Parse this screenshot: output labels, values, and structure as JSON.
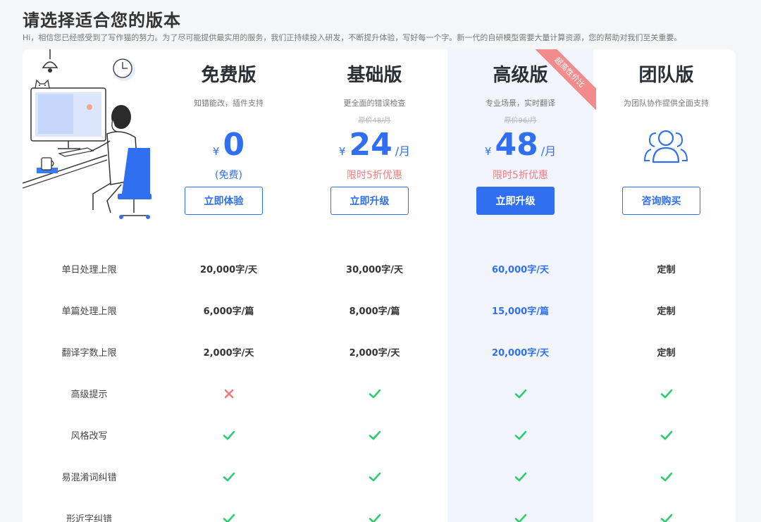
{
  "header": {
    "title": "请选择适合您的版本",
    "subtitle": "Hi，相信您已经感受到了写作猫的努力。为了尽可能提供最实用的服务，我们正持续投入研发，不断提升体验，写好每一个字。新一代的自研模型需要大量计算资源，您的帮助对我们至关重要。"
  },
  "plans": [
    {
      "name": "免费版",
      "desc": "知错能改，插件支持",
      "currency": "¥",
      "price": "0",
      "note": "(免费)",
      "button": "立即体验"
    },
    {
      "name": "基础版",
      "desc": "更全面的错误检查",
      "original": "原价48/月",
      "currency": "¥",
      "price": "24",
      "unit": "/月",
      "promo": "限时5折优惠",
      "button": "立即升级"
    },
    {
      "name": "高级版",
      "desc": "专业场景，实时翻译",
      "original": "原价96/月",
      "currency": "¥",
      "price": "48",
      "unit": "/月",
      "promo": "限时5折优惠",
      "button": "立即升级",
      "ribbon": "超高性价比"
    },
    {
      "name": "团队版",
      "desc": "为团队协作提供全面支持",
      "icon": "team-icon",
      "button": "咨询购买"
    }
  ],
  "features": [
    {
      "label": "单日处理上限",
      "values": [
        "20,000字/天",
        "30,000字/天",
        "60,000字/天",
        "定制"
      ]
    },
    {
      "label": "单篇处理上限",
      "values": [
        "6,000字/篇",
        "8,000字/篇",
        "15,000字/篇",
        "定制"
      ]
    },
    {
      "label": "翻译字数上限",
      "values": [
        "2,000字/天",
        "2,000字/天",
        "20,000字/天",
        "定制"
      ]
    },
    {
      "label": "高级提示",
      "values": [
        "cross",
        "check",
        "check",
        "check"
      ]
    },
    {
      "label": "风格改写",
      "values": [
        "check",
        "check",
        "check",
        "check"
      ]
    },
    {
      "label": "易混淆词纠错",
      "values": [
        "check",
        "check",
        "check",
        "check"
      ]
    },
    {
      "label": "形近字纠错",
      "values": [
        "check",
        "check",
        "check",
        "check"
      ]
    }
  ],
  "colors": {
    "accent": "#2f6ff0",
    "check": "#2ecc71",
    "cross": "#f07c7c",
    "promo": "#f07c7c",
    "highlight_bg": "#f3f5fe"
  }
}
